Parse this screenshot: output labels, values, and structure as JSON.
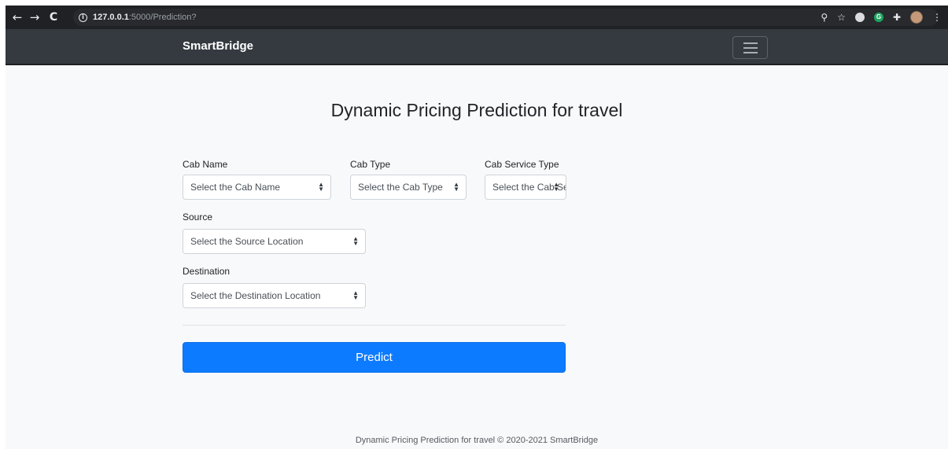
{
  "browser": {
    "url_host": "127.0.0.1",
    "url_rest": ":5000/Prediction?"
  },
  "navbar": {
    "brand": "SmartBridge"
  },
  "main": {
    "title": "Dynamic Pricing Prediction for travel",
    "fields": {
      "cab_name": {
        "label": "Cab Name",
        "value": "Select the Cab Name"
      },
      "cab_type": {
        "label": "Cab Type",
        "value": "Select the Cab Type"
      },
      "cab_service_type": {
        "label": "Cab Service Type",
        "value": "Select the Cab Service Type"
      },
      "source": {
        "label": "Source",
        "value": "Select the Source Location"
      },
      "destination": {
        "label": "Destination",
        "value": "Select the Destination Location"
      }
    },
    "predict_label": "Predict"
  },
  "footer": {
    "text": "Dynamic Pricing Prediction for travel © 2020-2021 SmartBridge"
  },
  "colors": {
    "navbar_bg": "#343a40",
    "primary_button": "#0d7bff",
    "page_bg": "#f8f9fa"
  }
}
